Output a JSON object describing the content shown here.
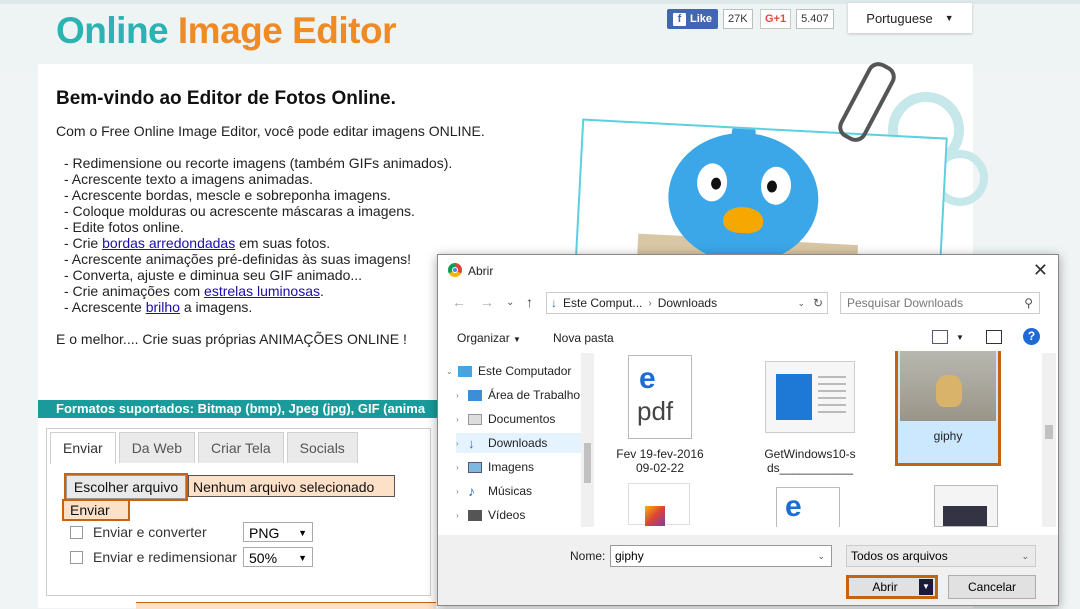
{
  "site": {
    "logo_part1": "Online ",
    "logo_part2": "Image Editor",
    "fb_like": "Like",
    "fb_count": "27K",
    "gplus_label": "G+1",
    "gplus_count": "5.407",
    "language": "Portuguese"
  },
  "welcome": {
    "title": "Bem-vindo ao Editor de Fotos Online.",
    "intro": "Com o Free Online Image Editor, você pode editar imagens ONLINE.",
    "bullets": {
      "b1": "- Redimensione ou recorte imagens (também GIFs animados).",
      "b2": "- Acrescente texto a imagens animadas.",
      "b3": "- Acrescente bordas, mescle e sobreponha imagens.",
      "b4": "- Coloque molduras ou acrescente máscaras a imagens.",
      "b5": "- Edite fotos online.",
      "b6_pre": "- Crie ",
      "b6_link": "bordas arredondadas",
      "b6_post": " em suas fotos.",
      "b7": "- Acrescente animações pré-definidas às suas imagens!",
      "b8": "- Converta, ajuste e diminua seu GIF animado...",
      "b9_pre": "- Crie animações com ",
      "b9_link": "estrelas luminosas",
      "b9_post": ".",
      "b10_pre": "- Acrescente ",
      "b10_link": "brilho",
      "b10_post": " a imagens."
    },
    "best": "E o melhor.... Crie suas próprias ANIMAÇÕES ONLINE !"
  },
  "formats": "Formatos suportados: Bitmap (bmp), Jpeg (jpg), GIF (anima",
  "upload": {
    "tabs": [
      "Enviar",
      "Da Web",
      "Criar Tela",
      "Socials"
    ],
    "choose_file": "Escolher arquivo",
    "no_file": "Nenhum arquivo selecionado",
    "send": "Enviar",
    "opt_convert": "Enviar e converter",
    "opt_convert_value": "PNG",
    "opt_resize": "Enviar e redimensionar",
    "opt_resize_value": "50%"
  },
  "dialog": {
    "title": "Abrir",
    "path_root": "Este Comput...",
    "path_folder": "Downloads",
    "search_placeholder": "Pesquisar Downloads",
    "organize": "Organizar",
    "new_folder": "Nova pasta",
    "tree": {
      "computer": "Este Computador",
      "desktop": "Área de Trabalho",
      "documents": "Documentos",
      "downloads": "Downloads",
      "images": "Imagens",
      "music": "Músicas",
      "videos": "Vídeos"
    },
    "files": {
      "f1_line1": "Fev 19-fev-2016",
      "f1_line2": "09-02-22",
      "f2_line1": "GetWindows10-s",
      "f2_line2": "ds___________",
      "f3": "giphy"
    },
    "filename_label": "Nome:",
    "filename_value": "giphy",
    "filetype": "Todos os arquivos",
    "open": "Abrir",
    "cancel": "Cancelar"
  },
  "colors": {
    "teal": "#2bb3b3",
    "orange": "#f08a24",
    "highlight": "#c7620f",
    "formats_bar": "#1a9a9a"
  }
}
